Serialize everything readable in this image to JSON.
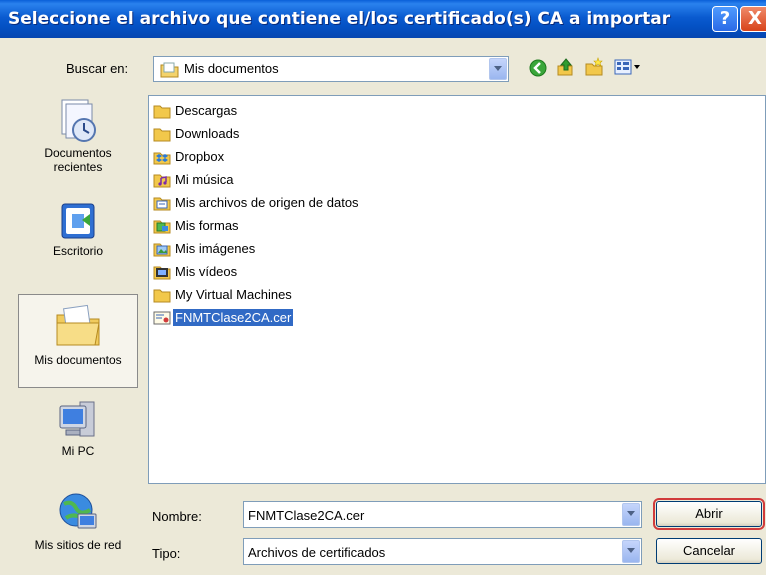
{
  "title": "Seleccione el archivo que contiene el/los certificado(s) CA a importar",
  "title_buttons": {
    "help": "?",
    "close": "X"
  },
  "lookin": {
    "label": "Buscar en:",
    "value": "Mis documentos"
  },
  "toolbar": {
    "icons": [
      "back-icon",
      "up-folder-icon",
      "new-folder-icon",
      "view-menu-icon"
    ]
  },
  "places": [
    {
      "label": "Documentos recientes",
      "icon": "recent-documents-icon"
    },
    {
      "label": "Escritorio",
      "icon": "desktop-icon"
    },
    {
      "label": "Mis documentos",
      "icon": "my-documents-icon",
      "selected": true
    },
    {
      "label": "Mi PC",
      "icon": "my-computer-icon"
    },
    {
      "label": "Mis sitios de red",
      "icon": "network-places-icon"
    }
  ],
  "files": [
    {
      "name": "Descargas",
      "icon": "folder-icon"
    },
    {
      "name": "Downloads",
      "icon": "folder-icon"
    },
    {
      "name": "Dropbox",
      "icon": "dropbox-icon"
    },
    {
      "name": "Mi música",
      "icon": "music-folder-icon"
    },
    {
      "name": "Mis archivos de origen de datos",
      "icon": "data-sources-folder-icon"
    },
    {
      "name": "Mis formas",
      "icon": "shapes-folder-icon"
    },
    {
      "name": "Mis imágenes",
      "icon": "pictures-folder-icon"
    },
    {
      "name": "Mis vídeos",
      "icon": "videos-folder-icon"
    },
    {
      "name": "My Virtual Machines",
      "icon": "folder-icon"
    },
    {
      "name": "FNMTClase2CA.cer",
      "icon": "certificate-file-icon",
      "selected": true
    }
  ],
  "filename": {
    "label": "Nombre:",
    "value": "FNMTClase2CA.cer"
  },
  "filetype": {
    "label": "Tipo:",
    "value": "Archivos de certificados"
  },
  "buttons": {
    "open": "Abrir",
    "cancel": "Cancelar"
  },
  "colors": {
    "titlebar": "#0a5bd0",
    "selection": "#316ac5",
    "dialog_bg": "#ece9d8"
  }
}
